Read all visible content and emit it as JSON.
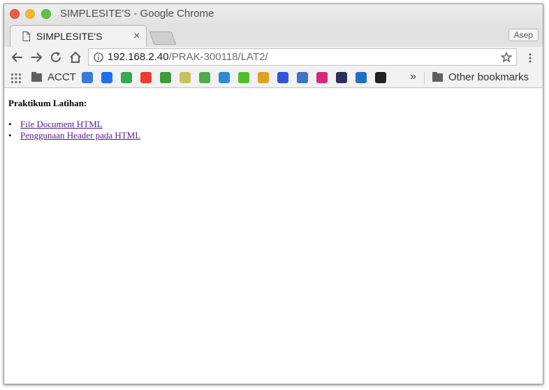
{
  "window": {
    "title": "SIMPLESITE'S - Google Chrome"
  },
  "tabs": [
    {
      "label": "SIMPLESITE'S",
      "close": "×"
    }
  ],
  "profile": {
    "name": "Asep"
  },
  "address": {
    "host": "192.168.2.40",
    "path": "/PRAK-300118/LAT2/"
  },
  "bookmarks": {
    "folder_label": "ACCT",
    "chevron": "»",
    "other_label": "Other bookmarks",
    "icons": [
      {
        "name": "star-compass-icon",
        "color": "#3a7bd5"
      },
      {
        "name": "digitalocean-icon",
        "color": "#1f6ff2"
      },
      {
        "name": "chrome-dev-icon",
        "color": "#34a853"
      },
      {
        "name": "youtube-icon",
        "color": "#ee3b2f"
      },
      {
        "name": "vectr-icon",
        "color": "#3f9b3a"
      },
      {
        "name": "g-icon",
        "color": "#c9c25a"
      },
      {
        "name": "w3-icon",
        "color": "#4cae4c"
      },
      {
        "name": "power-icon",
        "color": "#2b8ad8"
      },
      {
        "name": "upwork-icon",
        "color": "#4fbf2c"
      },
      {
        "name": "colorful-c-icon",
        "color": "#e0a020"
      },
      {
        "name": "atlassian-icon",
        "color": "#2f54d6"
      },
      {
        "name": "kemdikbud-icon",
        "color": "#3d74c6"
      },
      {
        "name": "instagram-icon",
        "color": "#d6297b"
      },
      {
        "name": "box-icon",
        "color": "#2c2f5a"
      },
      {
        "name": "trello-icon",
        "color": "#1f6fc2"
      },
      {
        "name": "record-icon",
        "color": "#222222"
      }
    ]
  },
  "page": {
    "heading": "Praktikum Latihan:",
    "links": [
      {
        "label": "File Document HTML"
      },
      {
        "label": "Penggunaan Header pada HTML"
      }
    ]
  }
}
